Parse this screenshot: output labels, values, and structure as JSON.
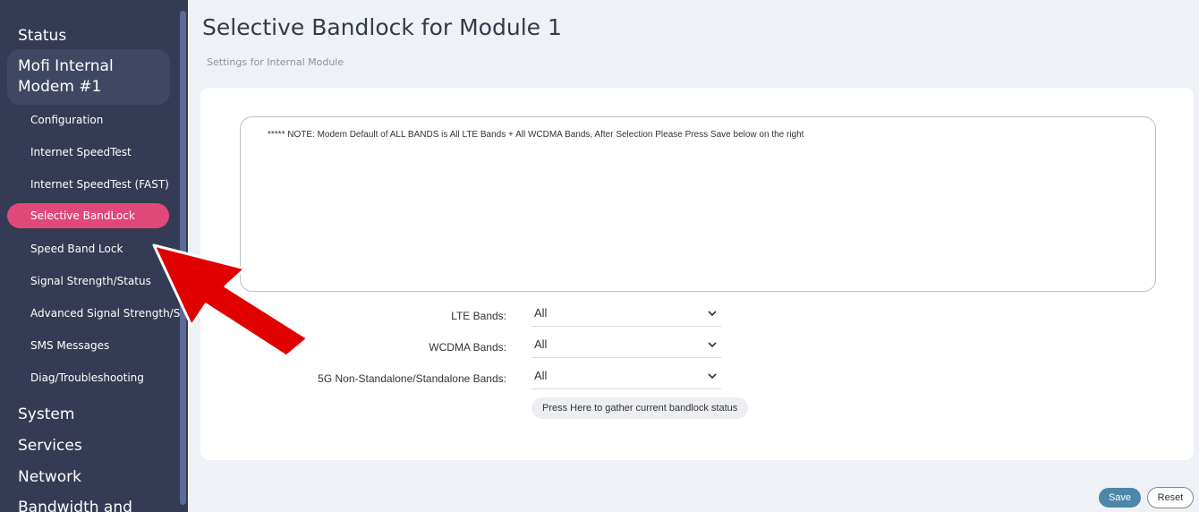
{
  "sidebar": {
    "sections": {
      "status": "Status",
      "modem_group": "Mofi Internal Modem #1",
      "system": "System",
      "services": "Services",
      "network": "Network",
      "bandwidth": "Bandwidth and"
    },
    "items": [
      {
        "label": "Configuration"
      },
      {
        "label": "Internet SpeedTest"
      },
      {
        "label": "Internet SpeedTest (FAST)"
      },
      {
        "label": "Selective BandLock",
        "active": true
      },
      {
        "label": "Speed Band Lock"
      },
      {
        "label": "Signal Strength/Status"
      },
      {
        "label": "Advanced Signal Strength/Status"
      },
      {
        "label": "SMS Messages"
      },
      {
        "label": "Diag/Troubleshooting"
      }
    ]
  },
  "main": {
    "title": "Selective Bandlock for Module 1",
    "subtitle": "Settings for Internal Module",
    "note": "***** NOTE: Modem Default of ALL BANDS is All LTE Bands + All WCDMA Bands, After Selection Please Press Save below on the right",
    "fields": [
      {
        "label": "LTE Bands:",
        "value": "All"
      },
      {
        "label": "WCDMA Bands:",
        "value": "All"
      },
      {
        "label": "5G Non-Standalone/Standalone Bands:",
        "value": "All"
      }
    ],
    "gather_button": "Press Here to gather current bandlock status"
  },
  "footer": {
    "save_label": "Save",
    "reset_label": "Reset"
  },
  "colors": {
    "sidebar_bg": "#353b54",
    "active_item": "#e0487a",
    "save_button": "#4d86a6",
    "arrow": "#e00000"
  },
  "icons": [
    "chevron-down-icon",
    "red-arrow-annotation"
  ]
}
